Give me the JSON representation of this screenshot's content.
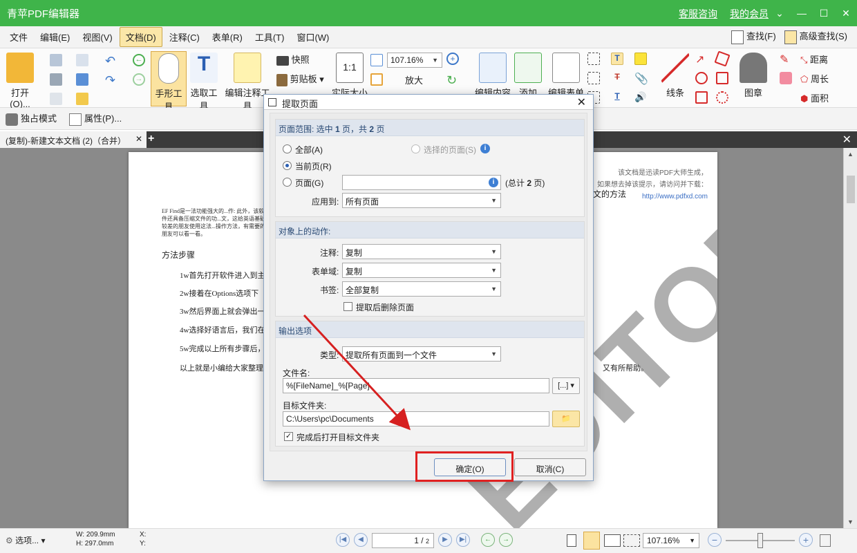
{
  "window": {
    "title": "青苹PDF编辑器",
    "links": [
      "客服咨询",
      "我的会员"
    ]
  },
  "menu": {
    "items": [
      "文件",
      "编辑(E)",
      "视图(V)",
      "文档(D)",
      "注释(C)",
      "表单(R)",
      "工具(T)",
      "窗口(W)"
    ],
    "active_index": 3,
    "find": "查找(F)",
    "advanced_find": "高级查找(S)"
  },
  "ribbon": {
    "open": "打开(O)...",
    "hand_tool": "手形工具",
    "select_text": "选取工具",
    "edit_annotation": "编辑注释工具",
    "snapshot": "快照",
    "clipboard": "剪贴板",
    "actual_size": "实际大小",
    "zoom_value": "107.16%",
    "zoom_in": "放大",
    "edit_content": "编辑内容",
    "add": "添加",
    "edit_form": "编辑表单",
    "line": "线条",
    "stamp": "图章",
    "distance": "距离",
    "perimeter": "周长",
    "area": "面积"
  },
  "subbar": {
    "exclusive_mode": "独占模式",
    "properties": "属性(P)..."
  },
  "tabs": [
    {
      "label": "(复制)-新建文本文档 (2)（合并）"
    }
  ],
  "document": {
    "note_lines": [
      "该文档是迅读PDF大师生成，",
      "如果想去掉该提示，请访问并下载："
    ],
    "note_url": "http://www.pdfxd.com",
    "heading_tail": "文的方法",
    "intro": "EF Find是一法功能强大的...作: 此外，该软件还具备压缩文件的功...文，这给英语基础较差的朋友使用这法...操作方法，有需要的朋友可以看一看。",
    "method_title": "方法步骤",
    "steps": [
      "1w首先打开软件进入到主",
      "2w接着在Options选项下",
      "3w然后界面上就会弹出一",
      "4w选择好语言后，我们在",
      "5w完成以上所有步骤后，"
    ],
    "summary": "以上就是小编给大家整理的",
    "summary_tail": "又有所帮助。",
    "watermark": "EDITOR"
  },
  "dialog": {
    "title": "提取页面",
    "page_range": {
      "header_prefix": "页面范围: 选中",
      "selected_count": "1",
      "header_mid": "页，共",
      "total_count": "2",
      "header_suffix": "页",
      "all_label": "全部(A)",
      "selected_pages_label": "选择的页面(S)",
      "current_page_label": "当前页(R)",
      "pages_label": "页面(G)",
      "pages_value": "",
      "total_text_prefix": "(总计",
      "total_text_suffix": "页)",
      "apply_to_label": "应用到:",
      "apply_to_value": "所有页面"
    },
    "actions": {
      "header": "对象上的动作:",
      "annotation_label": "注释:",
      "annotation_value": "复制",
      "form_field_label": "表单域:",
      "form_field_value": "复制",
      "bookmark_label": "书签:",
      "bookmark_value": "全部复制",
      "delete_after_label": "提取后删除页面",
      "delete_after_checked": false
    },
    "output": {
      "header": "输出选项",
      "type_label": "类型:",
      "type_value": "提取所有页面到一个文件",
      "filename_label": "文件名:",
      "filename_value": "%[FileName]_%[Page]",
      "folder_label": "目标文件夹:",
      "folder_value": "C:\\Users\\pc\\Documents",
      "open_folder_label": "完成后打开目标文件夹",
      "open_folder_checked": true
    },
    "ok_label": "确定(O)",
    "cancel_label": "取消(C)"
  },
  "statusbar": {
    "options": "选项...",
    "width": "W: 209.9mm",
    "height": "H: 297.0mm",
    "x": "X:",
    "y": "Y:",
    "page_current": "1",
    "page_total": "2",
    "zoom": "107.16%"
  },
  "colors": {
    "titlebar": "#3fb44a",
    "highlight": "#e02020",
    "dialog_header": "#2a4a74"
  }
}
